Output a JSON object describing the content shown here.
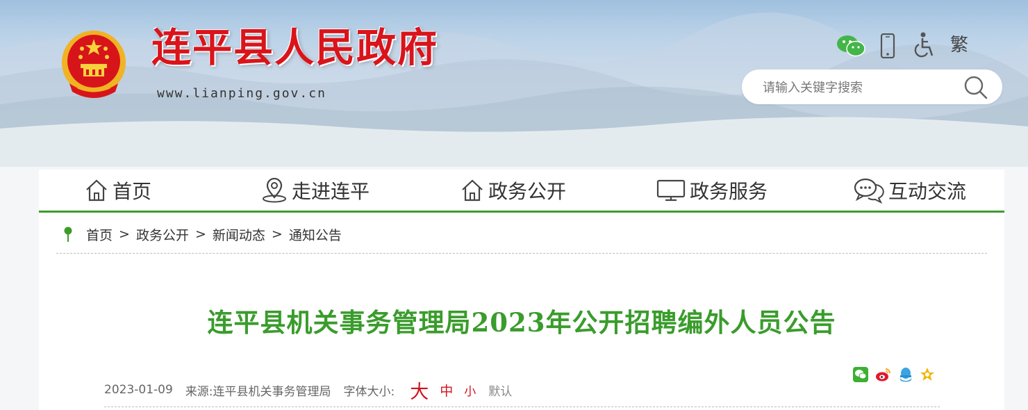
{
  "header": {
    "site_title": "连平县人民政府",
    "site_url": "www.lianping.gov.cn",
    "traditional_label": "繁",
    "search_placeholder": "请输入关键字搜索",
    "tools": [
      "wechat-icon",
      "mobile-icon",
      "accessibility-icon"
    ]
  },
  "nav": {
    "items": [
      {
        "label": "首页",
        "icon": "home-icon"
      },
      {
        "label": "走进连平",
        "icon": "location-icon"
      },
      {
        "label": "政务公开",
        "icon": "home-icon"
      },
      {
        "label": "政务服务",
        "icon": "monitor-icon"
      },
      {
        "label": "互动交流",
        "icon": "chat-icon"
      }
    ]
  },
  "breadcrumb": {
    "items": [
      "首页",
      "政务公开",
      "新闻动态",
      "通知公告"
    ],
    "separator": ">"
  },
  "article": {
    "title": "连平县机关事务管理局2023年公开招聘编外人员公告",
    "date": "2023-01-09",
    "source_label": "来源:",
    "source": "连平县机关事务管理局",
    "font_size_label": "字体大小:",
    "font_sizes": [
      "大",
      "中",
      "小",
      "默认"
    ]
  },
  "share": [
    "wechat-share-icon",
    "weibo-share-icon",
    "qq-share-icon",
    "favorite-icon"
  ],
  "colors": {
    "brand_red": "#d9141b",
    "green": "#3e9b2b",
    "title_green": "#3a9c2c"
  }
}
